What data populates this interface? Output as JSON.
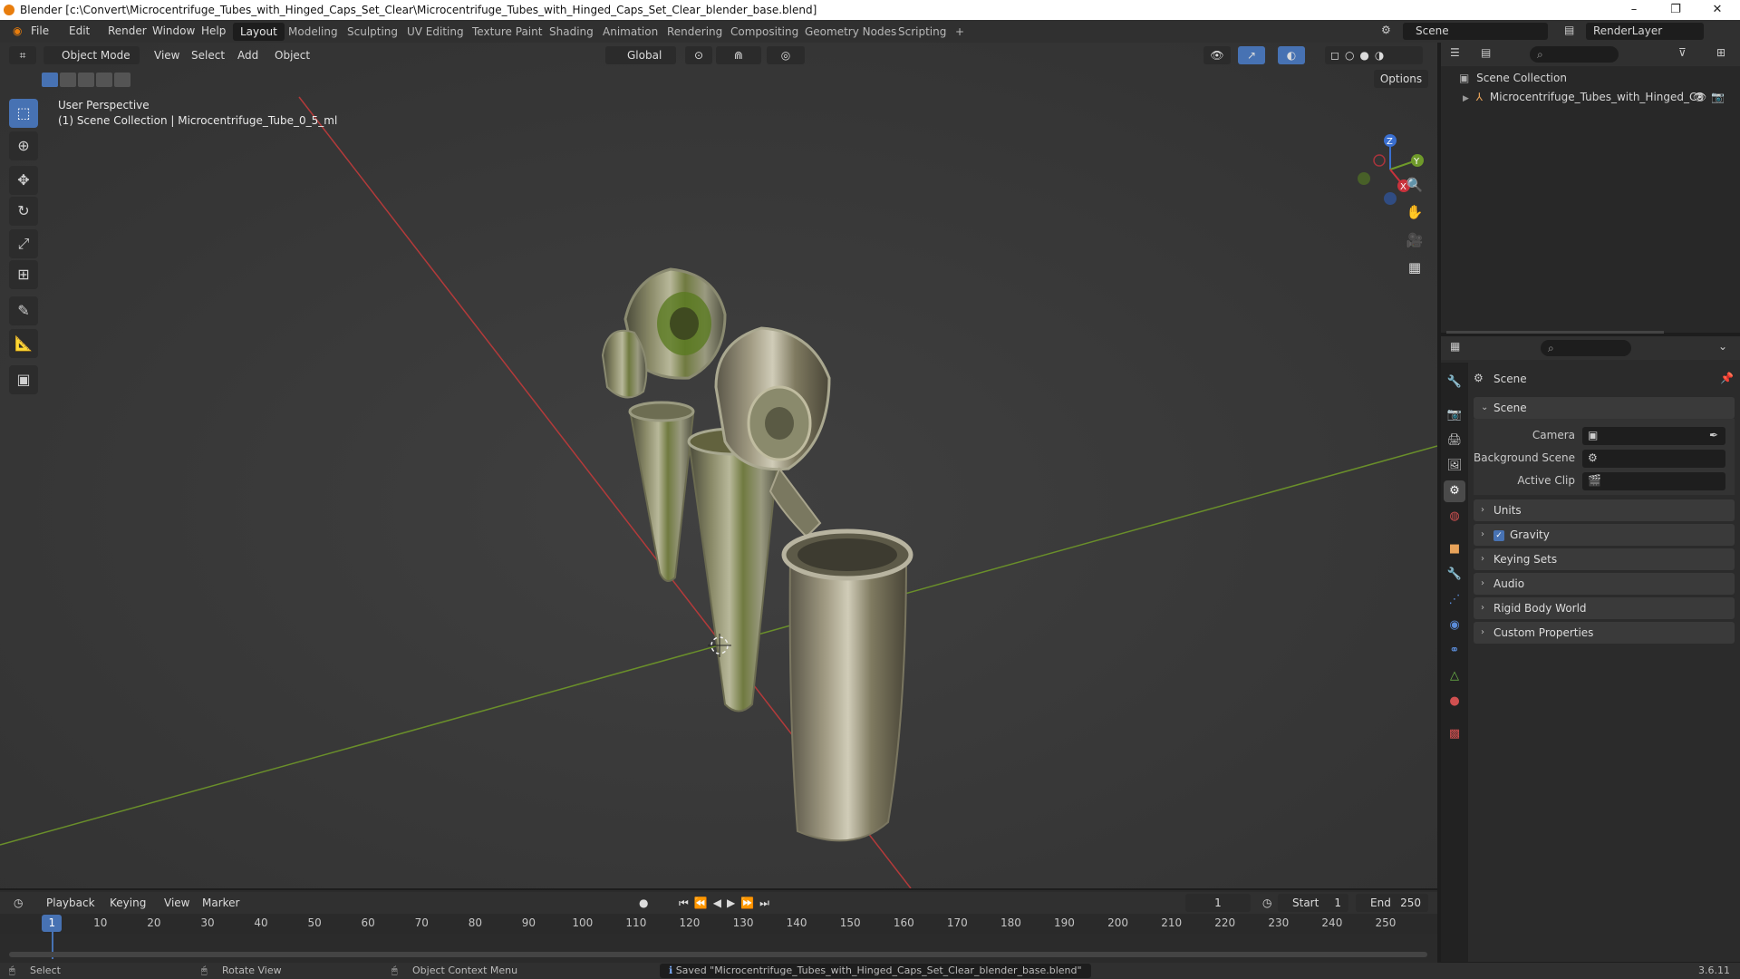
{
  "window": {
    "title": "Blender [c:\\Convert\\Microcentrifuge_Tubes_with_Hinged_Caps_Set_Clear\\Microcentrifuge_Tubes_with_Hinged_Caps_Set_Clear_blender_base.blend]",
    "min": "–",
    "max": "❐",
    "close": "✕"
  },
  "menubar": {
    "items": [
      "File",
      "Edit",
      "Render",
      "Window",
      "Help"
    ],
    "workspaces": [
      "Layout",
      "Modeling",
      "Sculpting",
      "UV Editing",
      "Texture Paint",
      "Shading",
      "Animation",
      "Rendering",
      "Compositing",
      "Geometry Nodes",
      "Scripting"
    ],
    "active_workspace": "Layout",
    "add_tab": "+",
    "scene_name": "Scene",
    "view_layer": "RenderLayer"
  },
  "viewport": {
    "mode": "Object Mode",
    "menus": [
      "View",
      "Select",
      "Add",
      "Object"
    ],
    "transform_orientation": "Global",
    "options": "Options",
    "overlay_line1": "User Perspective",
    "overlay_line2": "(1) Scene Collection | Microcentrifuge_Tube_0_5_ml",
    "gizmo": {
      "z": "Z",
      "y": "Y",
      "x": "X"
    }
  },
  "toolbar_icons": [
    "select-box-icon",
    "cursor-icon",
    "move-icon",
    "rotate-icon",
    "scale-icon",
    "transform-icon",
    "annotate-icon",
    "measure-icon",
    "add-cube-icon"
  ],
  "outliner": {
    "root": "Scene Collection",
    "items": [
      {
        "label": "Microcentrifuge_Tubes_with_Hinged_Ca"
      }
    ]
  },
  "properties": {
    "header": "Scene",
    "panel_scene": "Scene",
    "fields": [
      {
        "label": "Camera"
      },
      {
        "label": "Background Scene"
      },
      {
        "label": "Active Clip"
      }
    ],
    "subpanels": [
      "Units",
      "Gravity",
      "Keying Sets",
      "Audio",
      "Rigid Body World",
      "Custom Properties"
    ],
    "gravity_checked": true
  },
  "timeline": {
    "menus": [
      "Playback",
      "Keying",
      "View",
      "Marker"
    ],
    "current_frame": "1",
    "start_label": "Start",
    "start": "1",
    "end_label": "End",
    "end": "250",
    "ruler": [
      "1",
      "10",
      "20",
      "30",
      "40",
      "50",
      "60",
      "70",
      "80",
      "90",
      "100",
      "110",
      "120",
      "130",
      "140",
      "150",
      "160",
      "170",
      "180",
      "190",
      "200",
      "210",
      "220",
      "230",
      "240",
      "250"
    ]
  },
  "statusbar": {
    "select": "Select",
    "rotate": "Rotate View",
    "context": "Object Context Menu",
    "message": "Saved \"Microcentrifuge_Tubes_with_Hinged_Caps_Set_Clear_blender_base.blend\"",
    "version": "3.6.11"
  },
  "colors": {
    "accent": "#4772b3",
    "x_axis": "#c8323c",
    "y_axis": "#6f9a2a",
    "z_axis": "#3a6fd0"
  }
}
